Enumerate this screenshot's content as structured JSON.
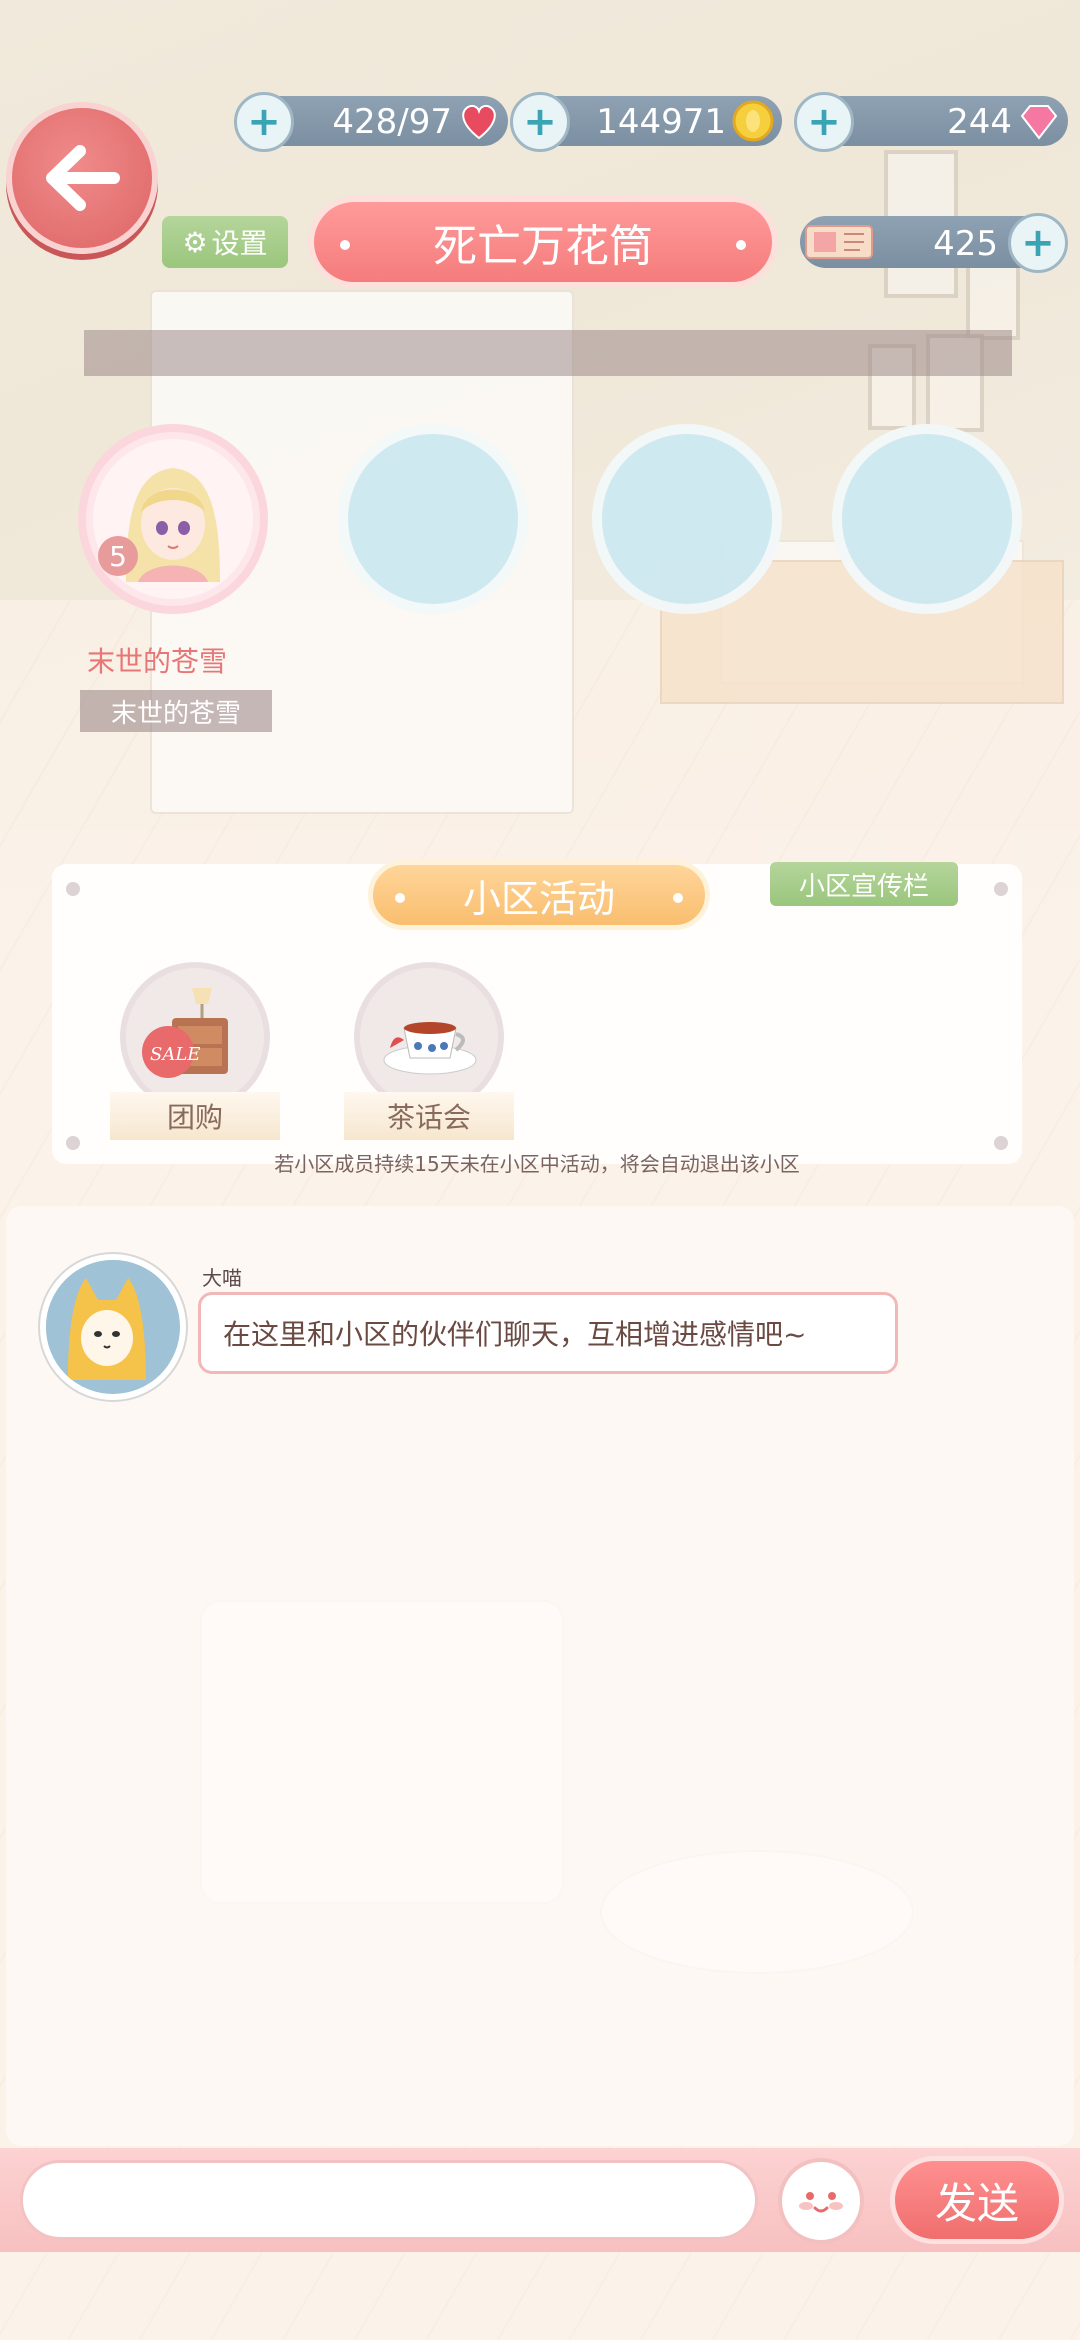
{
  "colors": {
    "accent": "#f57c7c",
    "green": "#9ac67d",
    "orange": "#f9be6e",
    "teal": "#3aa3b4"
  },
  "top_bar": {
    "hearts": {
      "value": "428/97",
      "icon": "heart-icon"
    },
    "coins": {
      "value": "144971",
      "icon": "coin-icon"
    },
    "gems": {
      "value": "244",
      "icon": "gem-icon"
    }
  },
  "header": {
    "settings_label": "设置",
    "title": "死亡万花筒",
    "tickets": {
      "value": "425",
      "icon": "ticket-icon"
    }
  },
  "members": [
    {
      "name": "末世的苍雪",
      "tag": "末世的苍雪",
      "level": "5"
    }
  ],
  "activities": {
    "title": "小区活动",
    "bulletin_label": "小区宣传栏",
    "items": [
      {
        "label": "团购",
        "icon": "nightstand-sale-icon"
      },
      {
        "label": "茶话会",
        "icon": "teacup-icon"
      }
    ],
    "note": "若小区成员持续15天未在小区中活动，将会自动退出该小区"
  },
  "chat": {
    "messages": [
      {
        "sender": "大喵",
        "text": "在这里和小区的伙伴们聊天，互相增进感情吧~"
      }
    ]
  },
  "composer": {
    "placeholder": "",
    "send_label": "发送"
  }
}
